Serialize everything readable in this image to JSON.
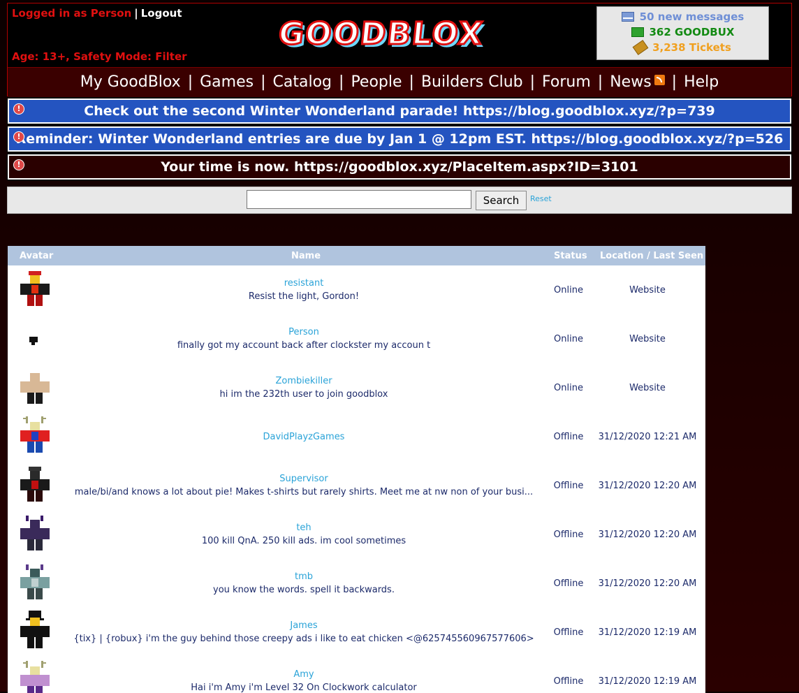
{
  "header": {
    "logged_in_text": "Logged in as Person",
    "separator": "|",
    "logout": "Logout",
    "age_line": "Age: 13+, Safety Mode: Filter",
    "logo_text": "GOODBLOX"
  },
  "stats": {
    "messages": "50 new messages",
    "goodbux": "362 GOODBUX",
    "tickets": "3,238 Tickets"
  },
  "nav": {
    "items": [
      "My GoodBlox",
      "Games",
      "Catalog",
      "People",
      "Builders Club",
      "Forum",
      "News",
      "Help"
    ],
    "separator": "|"
  },
  "banners": [
    {
      "text": "Check out the second Winter Wonderland parade! https://blog.goodblox.xyz/?p=739",
      "color": "#2454c0"
    },
    {
      "text": "Reminder: Winter Wonderland entries are due by Jan 1 @ 12pm EST. https://blog.goodblox.xyz/?p=526",
      "color": "#2454c0"
    },
    {
      "text": "Your time is now. https://goodblox.xyz/PlaceItem.aspx?ID=3101",
      "color": "#2a0000"
    }
  ],
  "search": {
    "value": "",
    "button": "Search",
    "reset": "Reset"
  },
  "table": {
    "headers": {
      "avatar": "Avatar",
      "name": "Name",
      "status": "Status",
      "seen": "Location / Last Seen"
    },
    "rows": [
      {
        "name": "resistant",
        "blurb": "Resist the light, Gordon!",
        "status": "Online",
        "seen": "Website",
        "avatar": "red-black-armor"
      },
      {
        "name": "Person",
        "blurb": "finally got my account back after clockster my accoun t",
        "status": "Online",
        "seen": "Website",
        "avatar": "tiny-black"
      },
      {
        "name": "Zombiekiller",
        "blurb": "hi im the 232th user to join goodblox",
        "status": "Online",
        "seen": "Website",
        "avatar": "tan-noob"
      },
      {
        "name": "DavidPlayzGames",
        "blurb": "",
        "status": "Offline",
        "seen": "31/12/2020 12:21 AM",
        "avatar": "antlers-blue"
      },
      {
        "name": "Supervisor",
        "blurb": "male/bi/and knows a lot about pie! Makes t-shirts but rarely shirts. Meet me at nw non of your busi...",
        "status": "Offline",
        "seen": "31/12/2020 12:20 AM",
        "avatar": "dark-red"
      },
      {
        "name": "teh",
        "blurb": "100 kill QnA. 250 kill ads. im cool sometimes",
        "status": "Offline",
        "seen": "31/12/2020 12:20 AM",
        "avatar": "purple-horns"
      },
      {
        "name": "tmb",
        "blurb": "you know the words. spell it backwards.",
        "status": "Offline",
        "seen": "31/12/2020 12:20 AM",
        "avatar": "teal-horns"
      },
      {
        "name": "James",
        "blurb": "{tix} | {robux} i'm the guy behind those creepy ads i like to eat chicken <@625745560967577606>",
        "status": "Offline",
        "seen": "31/12/2020 12:19 AM",
        "avatar": "black-tophat"
      },
      {
        "name": "Amy",
        "blurb": "Hai i'm Amy i'm Level 32 On Clockwork calculator",
        "status": "Offline",
        "seen": "31/12/2020 12:19 AM",
        "avatar": "antlers-purple"
      }
    ]
  }
}
